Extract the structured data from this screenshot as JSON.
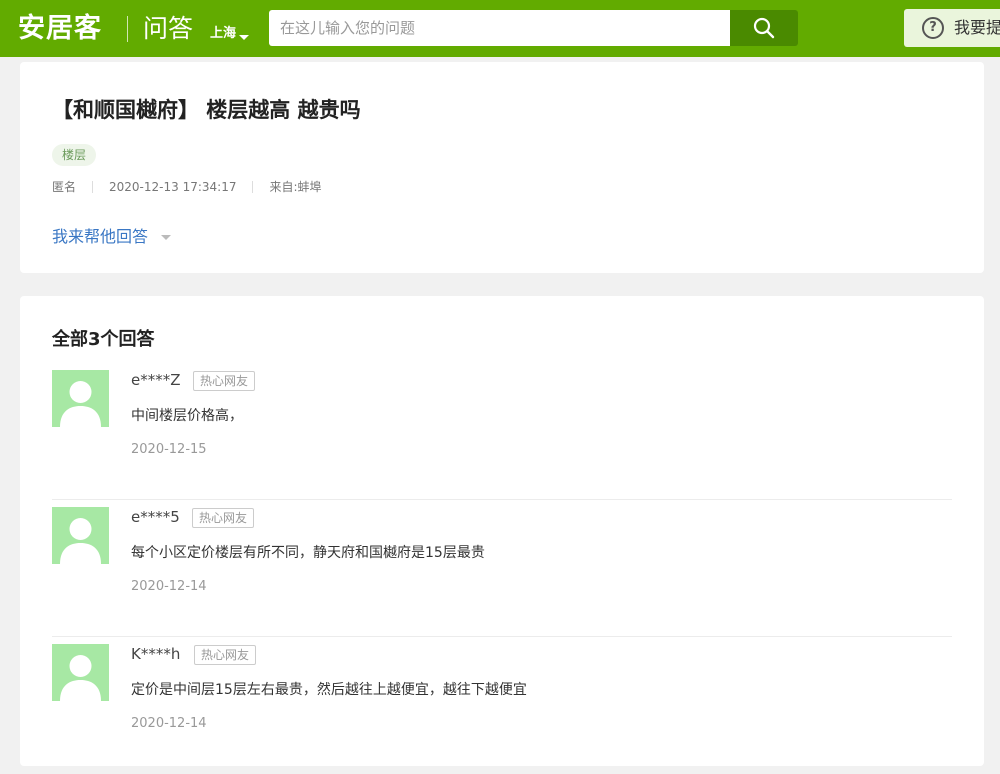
{
  "header": {
    "logo": "安居客",
    "section": "问答",
    "city": "上海",
    "search_placeholder": "在这儿输入您的问题",
    "ask_label": "我要提问"
  },
  "question": {
    "title": "【和顺国樾府】 楼层越高 越贵吗",
    "tag": "楼层",
    "author": "匿名",
    "time": "2020-12-13 17:34:17",
    "source": "来自:蚌埠",
    "help_label": "我来帮他回答"
  },
  "answers": {
    "heading": "全部3个回答",
    "items": [
      {
        "user": "e****Z",
        "badge": "热心网友",
        "content": "中间楼层价格高，",
        "date": "2020-12-15"
      },
      {
        "user": "e****5",
        "badge": "热心网友",
        "content": "每个小区定价楼层有所不同，静天府和国樾府是15层最贵",
        "date": "2020-12-14"
      },
      {
        "user": "K****h",
        "badge": "热心网友",
        "content": "定价是中间层15层左右最贵，然后越往上越便宜，越往下越便宜",
        "date": "2020-12-14"
      }
    ]
  },
  "colors": {
    "brand_green": "#62ab00",
    "link_blue": "#3a77c4",
    "avatar_green": "#a7e8a4"
  }
}
